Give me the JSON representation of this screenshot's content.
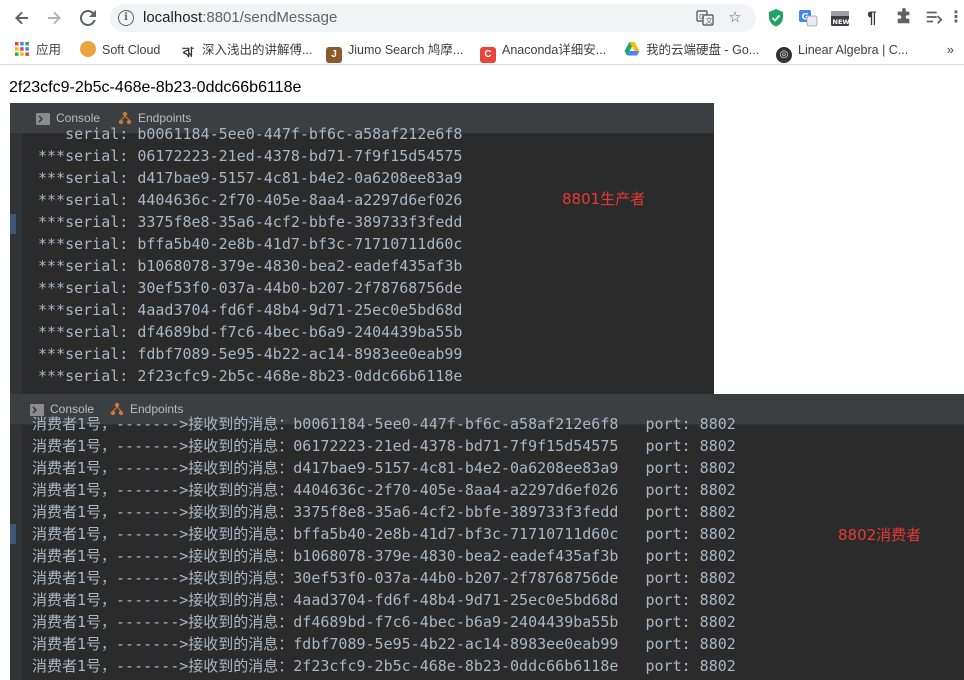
{
  "browser": {
    "url_host": "localhost",
    "url_path": ":8801/sendMessage",
    "bookmarks": [
      {
        "label": "应用",
        "icon": "apps-grid-icon",
        "color": "#4285f4"
      },
      {
        "label": "Soft Cloud",
        "icon": "soft-cloud-favicon",
        "color": "#e8a33d"
      },
      {
        "label": "深入浅出的讲解傅...",
        "icon": "zhihu-favicon",
        "color": "#555555"
      },
      {
        "label": "Jiumo Search 鸠摩...",
        "icon": "jiumo-favicon",
        "color": "#8b5a2b"
      },
      {
        "label": "Anaconda详细安...",
        "icon": "csdn-favicon",
        "color": "#e8453c"
      },
      {
        "label": "我的云端硬盘 - Go...",
        "icon": "google-drive-favicon",
        "color": "#1fa463"
      },
      {
        "label": "Linear Algebra | C...",
        "icon": "mit-favicon",
        "color": "#333333"
      }
    ],
    "more_bookmarks": "»"
  },
  "page": {
    "response_text": "2f23cfc9-2b5c-468e-8b23-0ddc66b6118e"
  },
  "producer_panel": {
    "tabs": [
      "Console",
      "Endpoints"
    ],
    "lines": [
      "   serial: b0061184-5ee0-447f-bf6c-a58af212e6f8",
      "***serial: 06172223-21ed-4378-bd71-7f9f15d54575",
      "***serial: d417bae9-5157-4c81-b4e2-0a6208ee83a9",
      "***serial: 4404636c-2f70-405e-8aa4-a2297d6ef026",
      "***serial: 3375f8e8-35a6-4cf2-bbfe-389733f3fedd",
      "***serial: bffa5b40-2e8b-41d7-bf3c-71710711d60c",
      "***serial: b1068078-379e-4830-bea2-eadef435af3b",
      "***serial: 30ef53f0-037a-44b0-b207-2f78768756de",
      "***serial: 4aad3704-fd6f-48b4-9d71-25ec0e5bd68d",
      "***serial: df4689bd-f7c6-4bec-b6a9-2404439ba55b",
      "***serial: fdbf7089-5e95-4b22-ac14-8983ee0eab99",
      "***serial: 2f23cfc9-2b5c-468e-8b23-0ddc66b6118e"
    ],
    "annotation": "8801生产者"
  },
  "consumer_panel": {
    "tabs": [
      "Console",
      "Endpoints"
    ],
    "lines": [
      "消费者1号，------->接收到的消息：b0061184-5ee0-447f-bf6c-a58af212e6f8   port: 8802",
      "消费者1号，------->接收到的消息：06172223-21ed-4378-bd71-7f9f15d54575   port: 8802",
      "消费者1号，------->接收到的消息：d417bae9-5157-4c81-b4e2-0a6208ee83a9   port: 8802",
      "消费者1号，------->接收到的消息：4404636c-2f70-405e-8aa4-a2297d6ef026   port: 8802",
      "消费者1号，------->接收到的消息：3375f8e8-35a6-4cf2-bbfe-389733f3fedd   port: 8802",
      "消费者1号，------->接收到的消息：bffa5b40-2e8b-41d7-bf3c-71710711d60c   port: 8802",
      "消费者1号，------->接收到的消息：b1068078-379e-4830-bea2-eadef435af3b   port: 8802",
      "消费者1号，------->接收到的消息：30ef53f0-037a-44b0-b207-2f78768756de   port: 8802",
      "消费者1号，------->接收到的消息：4aad3704-fd6f-48b4-9d71-25ec0e5bd68d   port: 8802",
      "消费者1号，------->接收到的消息：df4689bd-f7c6-4bec-b6a9-2404439ba55b   port: 8802",
      "消费者1号，------->接收到的消息：fdbf7089-5e95-4b22-ac14-8983ee0eab99   port: 8802",
      "消费者1号，------->接收到的消息：2f23cfc9-2b5c-468e-8b23-0ddc66b6118e   port: 8802"
    ],
    "annotation": "8802消费者"
  }
}
